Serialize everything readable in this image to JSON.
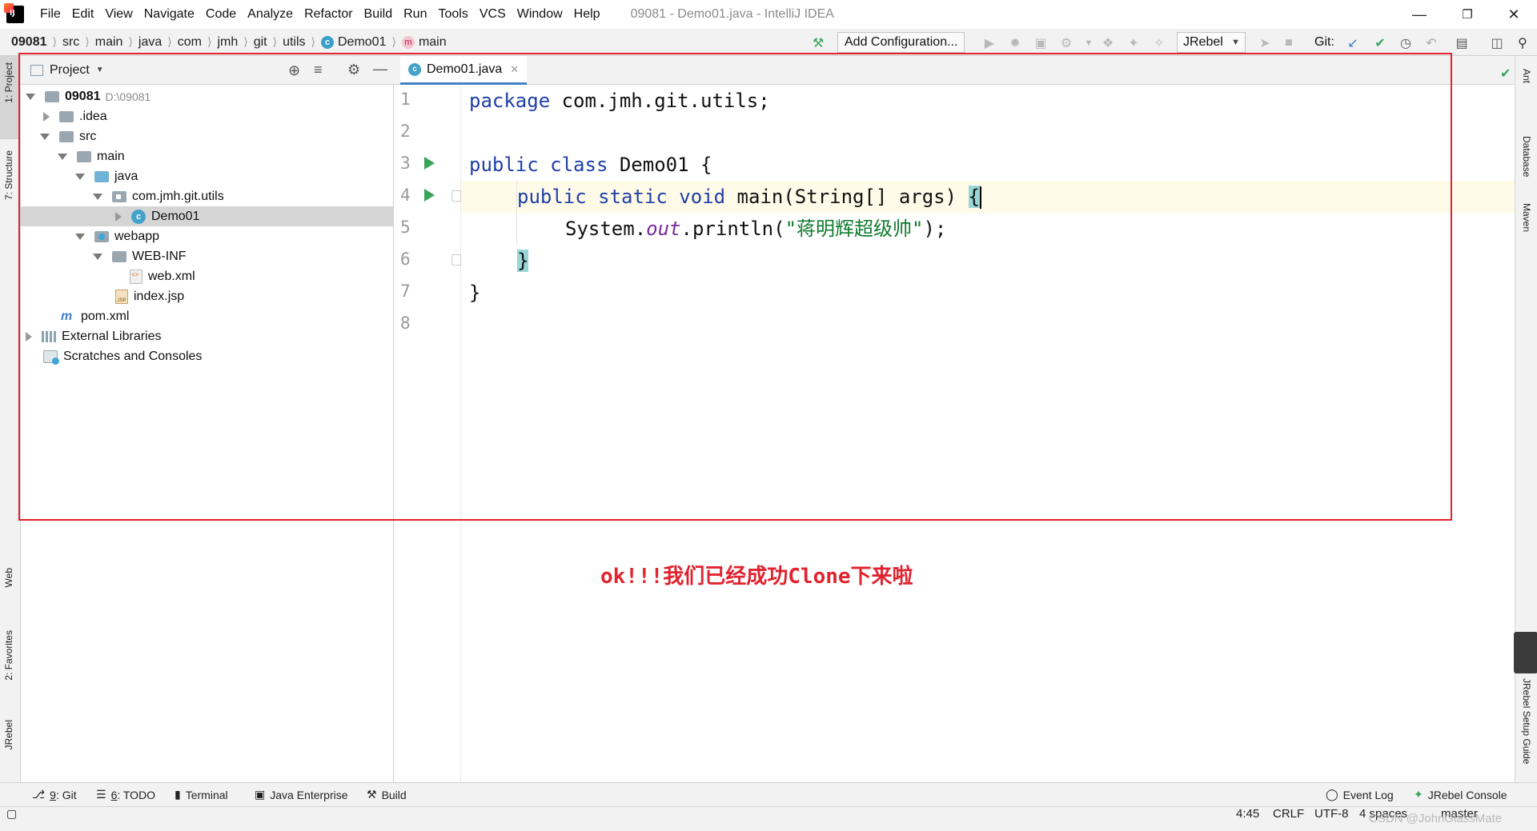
{
  "menubar": {
    "items": [
      "File",
      "Edit",
      "View",
      "Navigate",
      "Code",
      "Analyze",
      "Refactor",
      "Build",
      "Run",
      "Tools",
      "VCS",
      "Window",
      "Help"
    ],
    "title": "09081 - Demo01.java - IntelliJ IDEA"
  },
  "navbar": {
    "crumbs": [
      "09081",
      "src",
      "main",
      "java",
      "com",
      "jmh",
      "git",
      "utils",
      "Demo01",
      "main"
    ],
    "add_configuration": "Add Configuration...",
    "jrebel": "JRebel",
    "git_label": "Git:"
  },
  "project": {
    "title": "Project",
    "tree": [
      {
        "label": "09081",
        "extra": "D:\\09081"
      },
      {
        "label": ".idea"
      },
      {
        "label": "src"
      },
      {
        "label": "main"
      },
      {
        "label": "java"
      },
      {
        "label": "com.jmh.git.utils"
      },
      {
        "label": "Demo01"
      },
      {
        "label": "webapp"
      },
      {
        "label": "WEB-INF"
      },
      {
        "label": "web.xml"
      },
      {
        "label": "index.jsp"
      },
      {
        "label": "pom.xml"
      },
      {
        "label": "External Libraries"
      },
      {
        "label": "Scratches and Consoles"
      }
    ]
  },
  "editor": {
    "tab": "Demo01.java",
    "line_numbers": [
      "1",
      "2",
      "3",
      "4",
      "5",
      "6",
      "7",
      "8"
    ],
    "code": {
      "l1_kw": "package",
      "l1_rest": " com.jmh.git.utils;",
      "l3_kw": "public class",
      "l3_rest": " Demo01 {",
      "l4_kw": "public static void",
      "l4_rest": " main(String[] args) ",
      "l4_brace": "{",
      "l5_a": "System.",
      "l5_out": "out",
      "l5_b": ".println(",
      "l5_str": "\"蒋明辉超级帅\"",
      "l5_c": ");",
      "l6_brace": "}",
      "l7": "}"
    }
  },
  "annotation": "ok!!!我们已经成功Clone下来啦",
  "left_tabs": {
    "project": "1: Project",
    "structure": "7: Structure",
    "web": "Web",
    "favorites": "2: Favorites",
    "jrebel": "JRebel"
  },
  "right_tabs": {
    "ant": "Ant",
    "database": "Database",
    "maven": "Maven",
    "jrebel_guide": "JRebel Setup Guide"
  },
  "bottom_tabs": {
    "git_num": "9",
    "git": ": Git",
    "todo_num": "6",
    "todo": ": TODO",
    "terminal": "Terminal",
    "java_enterprise": "Java Enterprise",
    "build": "Build",
    "event_log": "Event Log",
    "jrebel_console": "JRebel Console"
  },
  "status": {
    "position": "4:45",
    "line_sep": "CRLF",
    "encoding": "UTF-8",
    "indent": "4 spaces",
    "branch": "master"
  },
  "watermark": "CSDN @JohnGlassMate",
  "colors": {
    "accent": "#4083c9",
    "annotation": "#e0232f",
    "run": "#3aa35a"
  }
}
